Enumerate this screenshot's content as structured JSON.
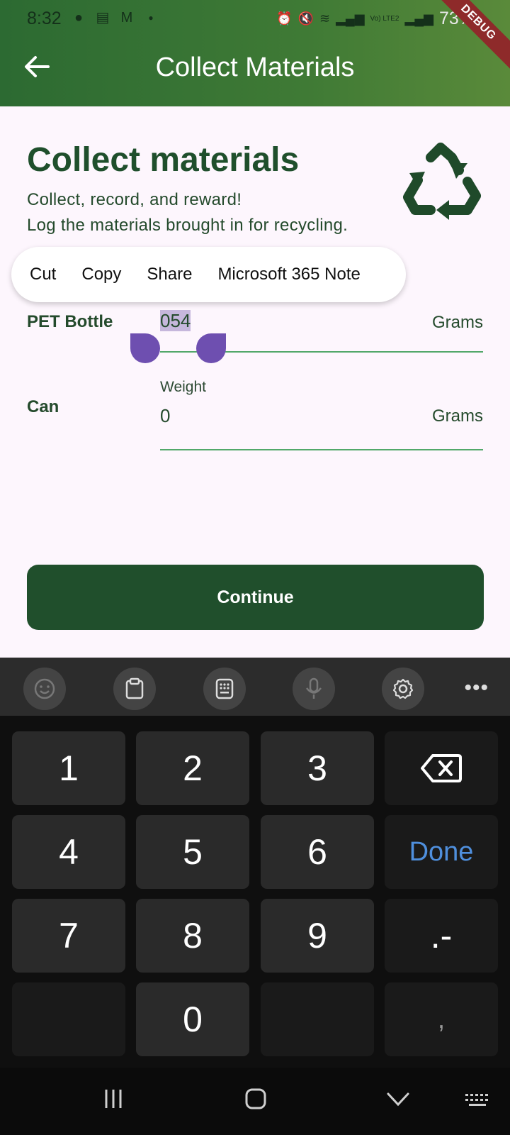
{
  "status_bar": {
    "time": "8:32",
    "battery": "73%",
    "network_label": "Vo) LTE2"
  },
  "debug_banner": "DEBUG",
  "app_bar": {
    "title": "Collect Materials",
    "back_icon": "arrow-left-icon"
  },
  "header": {
    "title": "Collect materials",
    "subtitle_line1": "Collect, record, and reward!",
    "subtitle_line2": "Log the materials brought in for recycling.",
    "icon": "recycle-icon"
  },
  "context_menu": {
    "items": [
      "Cut",
      "Copy",
      "Share",
      "Microsoft 365 Note"
    ]
  },
  "materials": [
    {
      "label": "PET Bottle",
      "value": "054",
      "unit": "Grams",
      "floating_label": "",
      "selected": true
    },
    {
      "label": "Can",
      "value": "0",
      "unit": "Grams",
      "floating_label": "Weight",
      "selected": false
    }
  ],
  "continue_button": "Continue",
  "keyboard": {
    "toolbar_icons": [
      "emoji-icon",
      "clipboard-icon",
      "keypad-icon",
      "mic-icon",
      "settings-icon",
      "more-icon"
    ],
    "keys": [
      "1",
      "2",
      "3",
      "4",
      "5",
      "6",
      "7",
      "8",
      "9",
      "0"
    ],
    "done_label": "Done",
    "punct_label": ".-",
    "comma_label": ","
  },
  "colors": {
    "primary": "#204f2c",
    "accent_line": "#52a86a",
    "handle": "#6e4fb0",
    "done_text": "#4f8fdd"
  }
}
